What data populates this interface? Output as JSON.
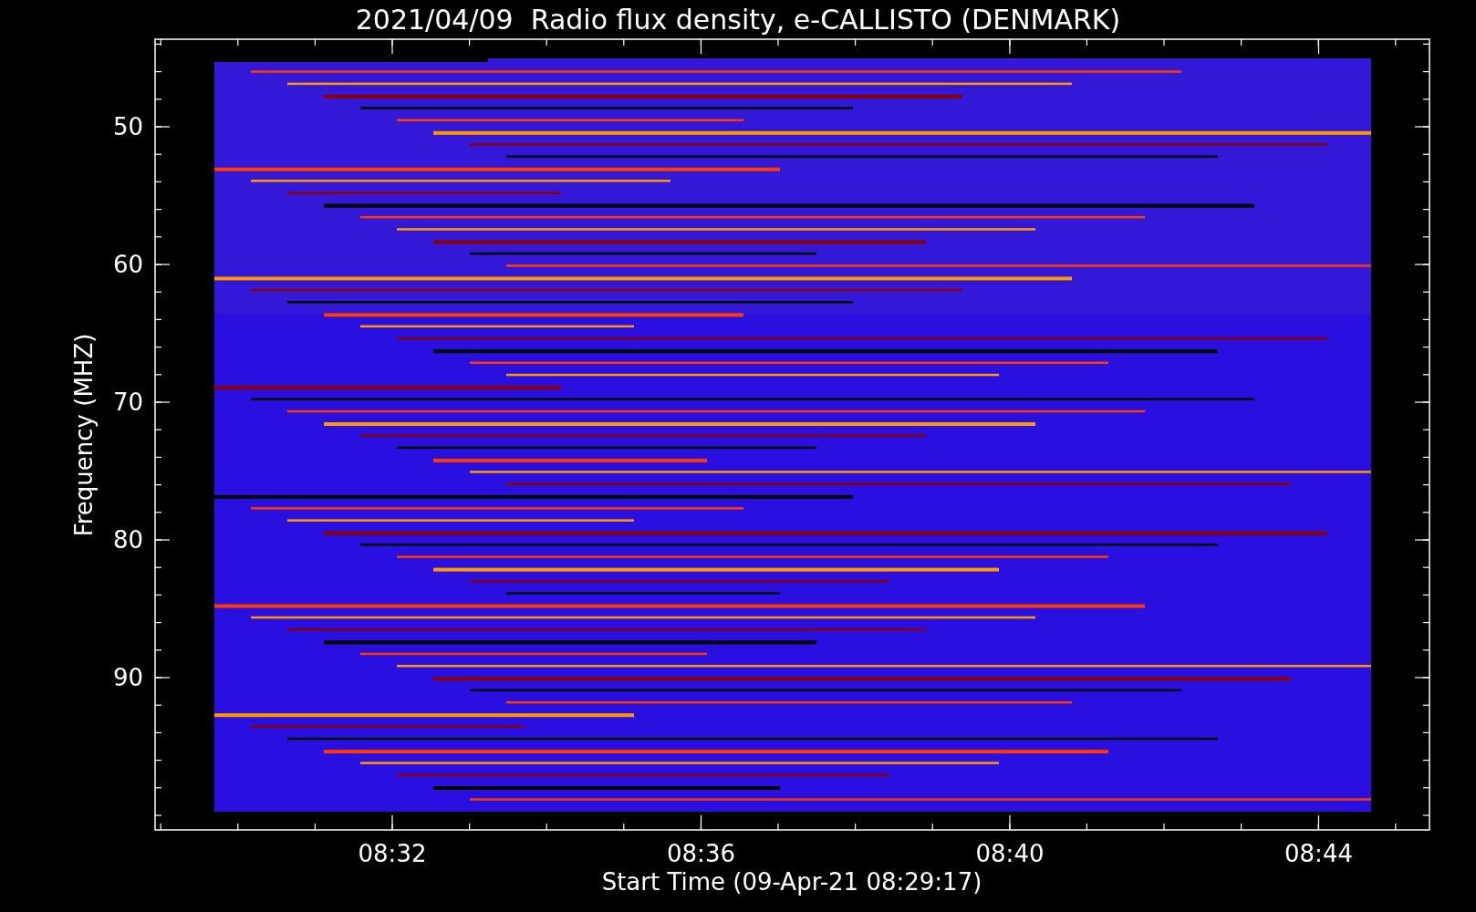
{
  "title": "2021/04/09  Radio flux density, e-CALLISTO (DENMARK)",
  "plot": {
    "ylabel": "Frequency (MHZ)",
    "xlabel": "Start Time (09-Apr-21 08:29:17)",
    "yticks": [
      "50",
      "60",
      "70",
      "80",
      "90"
    ],
    "xticks": [
      "08:32",
      "08:36",
      "08:40",
      "08:44"
    ]
  }
}
